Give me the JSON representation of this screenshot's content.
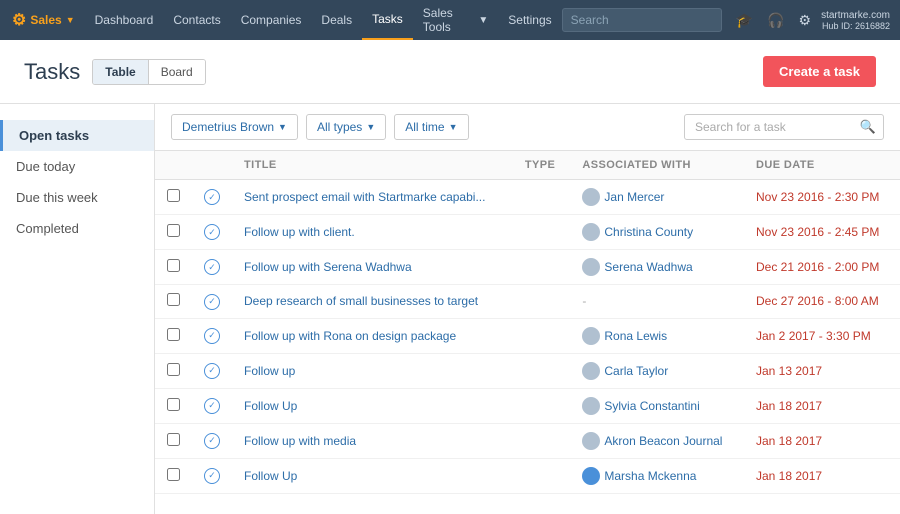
{
  "nav": {
    "brand": "Sales",
    "items": [
      {
        "label": "Dashboard",
        "active": false
      },
      {
        "label": "Contacts",
        "active": false
      },
      {
        "label": "Companies",
        "active": false
      },
      {
        "label": "Deals",
        "active": false
      },
      {
        "label": "Tasks",
        "active": true
      },
      {
        "label": "Sales Tools",
        "active": false,
        "caret": true
      },
      {
        "label": "Settings",
        "active": false
      }
    ],
    "search_placeholder": "Search",
    "account_name": "startmarke.com",
    "hub_id": "Hub ID: 2616882"
  },
  "page": {
    "title": "Tasks",
    "view_table": "Table",
    "view_board": "Board",
    "create_btn": "Create a task"
  },
  "sidebar": {
    "items": [
      {
        "label": "Open tasks",
        "active": true
      },
      {
        "label": "Due today",
        "active": false
      },
      {
        "label": "Due this week",
        "active": false
      },
      {
        "label": "Completed",
        "active": false
      }
    ]
  },
  "filters": {
    "owner": "Demetrius Brown",
    "type": "All types",
    "time": "All time",
    "search_placeholder": "Search for a task"
  },
  "table": {
    "columns": [
      "",
      "",
      "TITLE",
      "TYPE",
      "ASSOCIATED WITH",
      "DUE DATE"
    ],
    "rows": [
      {
        "title": "Sent prospect email with Startmarke capabi...",
        "type": "",
        "associated": "Jan Mercer",
        "due_date": "Nov 23 2016 - 2:30 PM",
        "avatar_color": "gray"
      },
      {
        "title": "Follow up with client.",
        "type": "",
        "associated": "Christina County",
        "due_date": "Nov 23 2016 - 2:45 PM",
        "avatar_color": "gray"
      },
      {
        "title": "Follow up with Serena Wadhwa",
        "type": "",
        "associated": "Serena Wadhwa",
        "due_date": "Dec 21 2016 - 2:00 PM",
        "avatar_color": "gray"
      },
      {
        "title": "Deep research of small businesses to target",
        "type": "",
        "associated": "-",
        "due_date": "Dec 27 2016 - 8:00 AM",
        "avatar_color": "none"
      },
      {
        "title": "Follow up with Rona on design package",
        "type": "",
        "associated": "Rona Lewis",
        "due_date": "Jan 2 2017 - 3:30 PM",
        "avatar_color": "gray"
      },
      {
        "title": "Follow up",
        "type": "",
        "associated": "Carla Taylor",
        "due_date": "Jan 13 2017",
        "avatar_color": "gray"
      },
      {
        "title": "Follow Up",
        "type": "",
        "associated": "Sylvia Constantini",
        "due_date": "Jan 18 2017",
        "avatar_color": "gray"
      },
      {
        "title": "Follow up with media",
        "type": "",
        "associated": "Akron Beacon Journal",
        "due_date": "Jan 18 2017",
        "avatar_color": "gray"
      },
      {
        "title": "Follow Up",
        "type": "",
        "associated": "Marsha Mckenna",
        "due_date": "Jan 18 2017",
        "avatar_color": "blue"
      }
    ]
  }
}
